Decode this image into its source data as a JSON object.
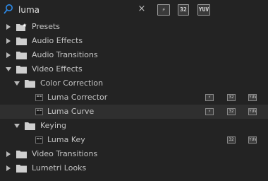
{
  "search": {
    "value": "luma",
    "clear_glyph": "×",
    "filters": [
      {
        "icon": "accelerated-effects-icon",
        "label": "⚡"
      },
      {
        "icon": "32-bit-color-icon",
        "label": "32"
      },
      {
        "icon": "yuv-icon",
        "label": "YUV"
      }
    ]
  },
  "tree": {
    "presets": {
      "label": "Presets",
      "expanded": false
    },
    "audio_effects": {
      "label": "Audio Effects",
      "expanded": false
    },
    "audio_transitions": {
      "label": "Audio Transitions",
      "expanded": false
    },
    "video_effects": {
      "label": "Video Effects",
      "expanded": true
    },
    "color_correction": {
      "label": "Color Correction",
      "expanded": true
    },
    "luma_corrector": {
      "label": "Luma Corrector",
      "badges": [
        "⚡",
        "32",
        "YUV"
      ]
    },
    "luma_curve": {
      "label": "Luma Curve",
      "badges": [
        "⚡",
        "32",
        "YUV"
      ],
      "selected": true
    },
    "keying": {
      "label": "Keying",
      "expanded": true
    },
    "luma_key": {
      "label": "Luma Key",
      "badges": [
        "32",
        "YUV"
      ]
    },
    "video_transitions": {
      "label": "Video Transitions",
      "expanded": false
    },
    "lumetri_looks": {
      "label": "Lumetri Looks",
      "expanded": false
    }
  },
  "colors": {
    "background": "#232323",
    "selected_row": "#2f2f2f",
    "text": "#c4c4c4",
    "accent": "#2d8ceb"
  }
}
